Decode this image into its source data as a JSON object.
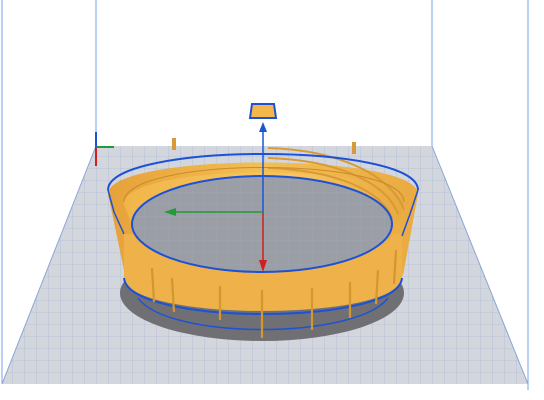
{
  "viewport": {
    "background_color": "#ffffff",
    "build_plate_color": "#d6d9de",
    "grid_line_color": "#8fa3c4",
    "volume_edge_color": "#7aa2e8",
    "model_color": "#f3b84c",
    "model_shadow_color": "#6f6f73",
    "model_outline_color": "#1d52d6"
  },
  "axes": {
    "x_color": "#d11f1f",
    "y_color": "#1f9b3a",
    "z_color": "#1a55d8"
  },
  "model": {
    "name_icon": "screw-cap-ring-model"
  }
}
